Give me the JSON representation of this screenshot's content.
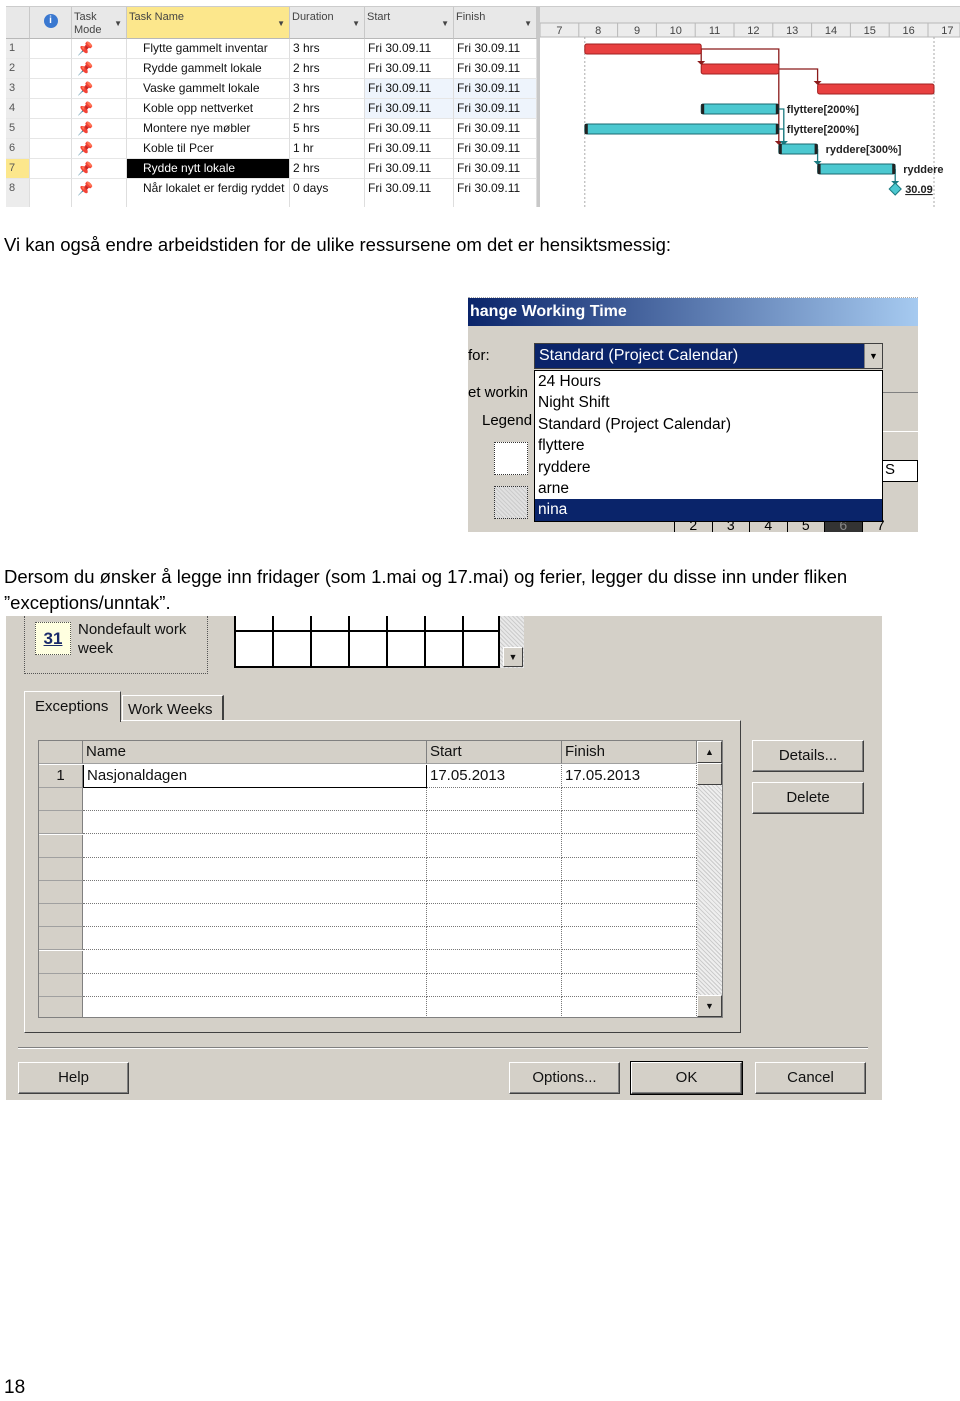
{
  "gantt": {
    "headers": {
      "task_mode": "Task Mode",
      "task_name": "Task Name",
      "duration": "Duration",
      "start": "Start",
      "finish": "Finish"
    },
    "icons": {
      "info": "info-icon",
      "mode": "pin-icon"
    },
    "rows": [
      {
        "n": "1",
        "name": "Flytte gammelt inventar",
        "duration": "3 hrs",
        "start": "Fri 30.09.11",
        "finish": "Fri 30.09.11"
      },
      {
        "n": "2",
        "name": "Rydde gammelt lokale",
        "duration": "2 hrs",
        "start": "Fri 30.09.11",
        "finish": "Fri 30.09.11"
      },
      {
        "n": "3",
        "name": "Vaske gammelt lokale",
        "duration": "3 hrs",
        "start": "Fri 30.09.11",
        "finish": "Fri 30.09.11"
      },
      {
        "n": "4",
        "name": "Koble opp nettverket",
        "duration": "2 hrs",
        "start": "Fri 30.09.11",
        "finish": "Fri 30.09.11"
      },
      {
        "n": "5",
        "name": "Montere nye møbler",
        "duration": "5 hrs",
        "start": "Fri 30.09.11",
        "finish": "Fri 30.09.11"
      },
      {
        "n": "6",
        "name": "Koble til Pcer",
        "duration": "1 hr",
        "start": "Fri 30.09.11",
        "finish": "Fri 30.09.11"
      },
      {
        "n": "7",
        "name": "Rydde nytt lokale",
        "duration": "2 hrs",
        "start": "Fri 30.09.11",
        "finish": "Fri 30.09.11",
        "selected": true
      },
      {
        "n": "8",
        "name": "Når lokalet er ferdig ryddet",
        "duration": "0 days",
        "start": "Fri 30.09.11",
        "finish": "Fri 30.09.11"
      }
    ],
    "timescale": [
      "7",
      "8",
      "9",
      "10",
      "11",
      "12",
      "13",
      "14",
      "15",
      "16",
      "17"
    ],
    "bars": [
      {
        "row": 1,
        "start": 8,
        "end": 11,
        "color": "#e84040"
      },
      {
        "row": 2,
        "start": 11,
        "end": 13,
        "color": "#e84040"
      },
      {
        "row": 3,
        "start": 14,
        "end": 17,
        "color": "#e84040"
      },
      {
        "row": 4,
        "start": 11,
        "end": 13,
        "color": "#4cc8d0",
        "label": "flyttere[200%]"
      },
      {
        "row": 5,
        "start": 8,
        "end": 13,
        "color": "#4cc8d0",
        "label": "flyttere[200%]"
      },
      {
        "row": 6,
        "start": 13,
        "end": 14,
        "color": "#4cc8d0",
        "label": "ryddere[300%]"
      },
      {
        "row": 7,
        "start": 14,
        "end": 16,
        "color": "#4cc8d0",
        "label": "ryddere"
      },
      {
        "row": 8,
        "start": 16,
        "end": 16,
        "milestone": true,
        "color": "#4cc8d0",
        "label": "30.09"
      }
    ]
  },
  "text1": "Vi kan også endre arbeidstiden for de ulike ressursene om det er hensiktsmessig:",
  "dialog1": {
    "title": "hange Working Time",
    "for_label": "for:",
    "set_label": "et workin",
    "legend_label": "Legend",
    "combo_value": "Standard (Project Calendar)",
    "options": [
      "24 Hours",
      "Night Shift",
      "Standard (Project Calendar)",
      "flyttere",
      "ryddere",
      "arne",
      "nina"
    ],
    "selected_option": "nina",
    "cal_letter": "S",
    "cal_days": [
      "2",
      "3",
      "4",
      "5",
      "6",
      "7"
    ],
    "accent": "#0a246a"
  },
  "text2": "Dersom du ønsker å legge inn fridager (som 1.mai og 17.mai) og ferier, legger du disse inn under fliken ”exceptions/unntak”.",
  "dialog2": {
    "legend_day": "31",
    "legend_text": "Nondefault work week",
    "tabs": [
      "Exceptions",
      "Work Weeks"
    ],
    "columns": [
      "Name",
      "Start",
      "Finish"
    ],
    "rows": [
      {
        "n": "1",
        "name": "Nasjonaldagen",
        "start": "17.05.2013",
        "finish": "17.05.2013"
      }
    ],
    "details": "Details...",
    "delete": "Delete",
    "help": "Help",
    "options": "Options...",
    "ok": "OK",
    "cancel": "Cancel"
  },
  "page_number": "18"
}
